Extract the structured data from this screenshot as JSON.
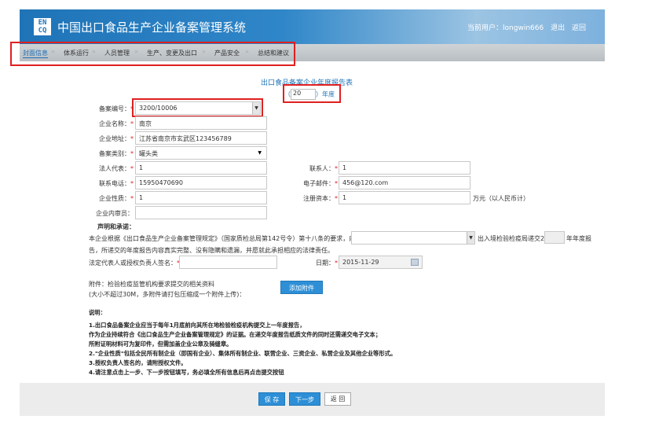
{
  "header": {
    "logo_text": "EN CQ",
    "title": "中国出口食品生产企业备案管理系统",
    "user_label": "当前用户：longwin666",
    "logout": "退出",
    "back": "返回"
  },
  "nav": {
    "items": [
      "封面信息",
      "体系运行",
      "人员管理",
      "生产、变更及出口",
      "产品安全",
      "总结和建议"
    ]
  },
  "form": {
    "title": "出口食品备案企业年度报告表",
    "year_open": "（",
    "year_value": "20",
    "year_close": "）年度",
    "record_no_label": "备案编号：",
    "record_no_value": "3200/10006",
    "company_name_label": "企业名称：",
    "company_name_value": "南京",
    "company_addr_label": "企业地址：",
    "company_addr_value": "江苏省南京市玄武区123456789",
    "record_type_label": "备案类别：",
    "record_type_value": "罐头类",
    "legal_rep_label": "法人代表：",
    "legal_rep_value": "1",
    "contact_label": "联系人：",
    "contact_value": "1",
    "phone_label": "联系电话：",
    "phone_value": "15950470690",
    "email_label": "电子邮件：",
    "email_value": "456@120.com",
    "nature_label": "企业性质：",
    "nature_value": "1",
    "capital_label": "注册资本：",
    "capital_value": "1",
    "capital_unit": "万元（以人民币计）",
    "reviewer_label": "企业内审员：",
    "reviewer_value": "",
    "declaration_heading": "声明和承诺：",
    "declaration_line1a": "本企业根据《出口食品生产企业备案管理规定》（国家质检总局第142号令）第十八条的要求，向",
    "declaration_line1b": "出入境检验检疫局递交20",
    "declaration_line1c": "年年度报",
    "declaration_line2": "告，所递交的年度报告内容真实完整、没有隐瞒和遗漏，并愿就此承担相应的法律责任。",
    "signer_label": "法定代表人或授权负责人签名：",
    "date_label": "日期：",
    "date_value": "2015-11-29",
    "attachment_line1": "附件：检验检疫监管机构要求提交的相关资料",
    "attachment_line2": "(大小不超过30M，多附件请打包压缩成一个附件上传)：",
    "add_attachment": "添加附件"
  },
  "notes": {
    "heading": "说明：",
    "lines": [
      "1.出口食品备案企业应当于每年1月底前向其所在地检验检疫机构提交上一年度报告，",
      "作为企业持续符合《出口食品生产企业备案管理规定》的证据。在递交年度报告纸质文件的同时还需递交电子文本；",
      "所附证明材料可为复印件，但需加盖企业公章及骑缝章。",
      "2.\"企业性质\"包括全民所有制企业（即国有企业）、集体所有制企业、联营企业、三资企业、私营企业及其他企业等形式。",
      "3.授权负责人签名的，请附授权文件。",
      "4.请注意点击上一步、下一步按钮填写，务必填全所有信息后再点击提交按钮"
    ]
  },
  "buttons": {
    "save": "保 存",
    "next": "下一步",
    "back": "返 回"
  }
}
